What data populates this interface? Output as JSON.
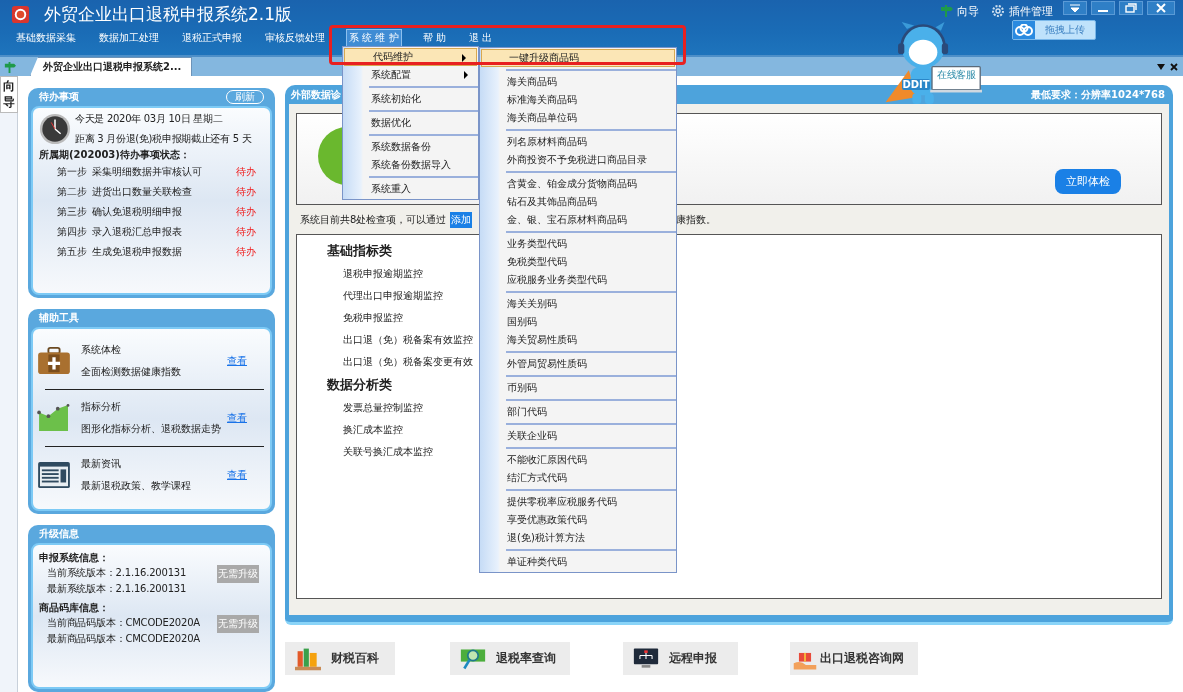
{
  "window": {
    "title": "外贸企业出口退税申报系统2.1版"
  },
  "title_actions": [
    {
      "kind": "guide",
      "label": "向导"
    },
    {
      "kind": "plugin",
      "label": "插件管理"
    }
  ],
  "upload_button": {
    "label": "拖拽上传"
  },
  "menu_bar": [
    {
      "label": "基础数据采集",
      "selected": false
    },
    {
      "label": "数据加工处理",
      "selected": false
    },
    {
      "label": "退税正式申报",
      "selected": false
    },
    {
      "label": "审核反馈处理",
      "selected": false
    },
    {
      "label": "系 统 维 护",
      "selected": true
    },
    {
      "label": "帮 助",
      "selected": false
    },
    {
      "label": "退 出",
      "selected": false
    }
  ],
  "system_menu": {
    "groups": [
      [
        {
          "label": "代码维护",
          "selected": true,
          "has_submenu": true
        },
        {
          "label": "系统配置",
          "selected": false,
          "has_submenu": true
        }
      ],
      [
        {
          "label": "系统初始化",
          "selected": false,
          "has_submenu": false
        }
      ],
      [
        {
          "label": "数据优化",
          "selected": false,
          "has_submenu": false
        }
      ],
      [
        {
          "label": "系统数据备份",
          "selected": false,
          "has_submenu": false
        },
        {
          "label": "系统备份数据导入",
          "selected": false,
          "has_submenu": false
        }
      ],
      [
        {
          "label": "系统重入",
          "selected": false,
          "has_submenu": false
        }
      ]
    ]
  },
  "code_submenu": {
    "groups": [
      [
        {
          "label": "一键升级商品码",
          "selected": true
        }
      ],
      [
        {
          "label": "海关商品码",
          "selected": false
        },
        {
          "label": "标准海关商品码",
          "selected": false
        },
        {
          "label": "海关商品单位码",
          "selected": false
        }
      ],
      [
        {
          "label": "列名原材料商品码",
          "selected": false
        },
        {
          "label": "外商投资不予免税进口商品目录",
          "selected": false
        }
      ],
      [
        {
          "label": "含黄金、铂金成分货物商品码",
          "selected": false
        },
        {
          "label": "钻石及其饰品商品码",
          "selected": false
        },
        {
          "label": "金、银、宝石原材料商品码",
          "selected": false
        }
      ],
      [
        {
          "label": "业务类型代码",
          "selected": false
        },
        {
          "label": "免税类型代码",
          "selected": false
        },
        {
          "label": "应税服务业务类型代码",
          "selected": false
        }
      ],
      [
        {
          "label": "海关关别码",
          "selected": false
        },
        {
          "label": "国别码",
          "selected": false
        },
        {
          "label": "海关贸易性质码",
          "selected": false
        }
      ],
      [
        {
          "label": "外管局贸易性质码",
          "selected": false
        }
      ],
      [
        {
          "label": "币别码",
          "selected": false
        }
      ],
      [
        {
          "label": "部门代码",
          "selected": false
        }
      ],
      [
        {
          "label": "关联企业码",
          "selected": false
        }
      ],
      [
        {
          "label": "不能收汇原因代码",
          "selected": false
        },
        {
          "label": "结汇方式代码",
          "selected": false
        }
      ],
      [
        {
          "label": "提供零税率应税服务代码",
          "selected": false
        },
        {
          "label": "享受优惠政策代码",
          "selected": false
        },
        {
          "label": "退(免)税计算方法",
          "selected": false
        }
      ],
      [
        {
          "label": "单证种类代码",
          "selected": false
        }
      ]
    ]
  },
  "doc_tabs": [
    {
      "label": "外贸企业出口退税申报系统2...",
      "selected": true
    }
  ],
  "side_tab": {
    "label": "向导"
  },
  "todo_panel": {
    "title": "待办事项",
    "refresh": "刷新",
    "date_line": "今天是 2020年 03月 10日 星期二",
    "deadline_line": "距离 3 月份退(免)税申报期截止还有 5 天",
    "period_heading": "所属期(202003)待办事项状态：",
    "steps": [
      {
        "step": "第一步",
        "task": "采集明细数据并审核认可",
        "status": "待办"
      },
      {
        "step": "第二步",
        "task": "进货出口数量关联检查",
        "status": "待办"
      },
      {
        "step": "第三步",
        "task": "确认免退税明细申报",
        "status": "待办"
      },
      {
        "step": "第四步",
        "task": "录入退税汇总申报表",
        "status": "待办"
      },
      {
        "step": "第五步",
        "task": "生成免退税申报数据",
        "status": "待办"
      }
    ]
  },
  "tools_panel": {
    "title": "辅助工具",
    "items": [
      {
        "kind": "checkup",
        "name": "系统体检",
        "desc": "全面检测数据健康指数",
        "link": "查看"
      },
      {
        "kind": "analysis",
        "name": "指标分析",
        "desc": "图形化指标分析、退税数据走势",
        "link": "查看"
      },
      {
        "kind": "news",
        "name": "最新资讯",
        "desc": "最新退税政策、教学课程",
        "link": "查看"
      }
    ]
  },
  "upgrade_panel": {
    "title": "升级信息",
    "sections": [
      {
        "heading": "申报系统信息：",
        "rows": [
          "当前系统版本：2.1.16.200131",
          "最新系统版本：2.1.16.200131"
        ],
        "button": "无需升级"
      },
      {
        "heading": "商品码库信息：",
        "rows": [
          "当前商品码版本：CMCODE2020A",
          "最新商品码版本：CMCODE2020A"
        ],
        "button": "无需升级"
      }
    ]
  },
  "diagnosis_panel": {
    "title": "外部数据诊",
    "requirement": "最低要求：分辨率1024*768",
    "check_button": "立即体检",
    "summary": "系统目前共8处检查项，可以通过",
    "add_button": "添加",
    "summary_tail": "康指数。",
    "categories": [
      {
        "name": "基础指标类",
        "items": [
          "退税申报逾期监控",
          "代理出口申报逾期监控",
          "免税申报监控",
          "出口退（免）税备案有效监控",
          "出口退（免）税备案变更有效"
        ]
      },
      {
        "name": "数据分析类",
        "items": [
          "发票总量控制监控",
          "换汇成本监控",
          "关联号换汇成本监控"
        ]
      }
    ]
  },
  "bottom_links": [
    {
      "kind": "books",
      "label": "财税百科"
    },
    {
      "kind": "rate",
      "label": "退税率查询"
    },
    {
      "kind": "remote",
      "label": "远程申报"
    },
    {
      "kind": "gift",
      "label": "出口退税咨询网"
    }
  ],
  "mascot": {
    "screen_text": "在线客服",
    "badge": "DDIT"
  }
}
